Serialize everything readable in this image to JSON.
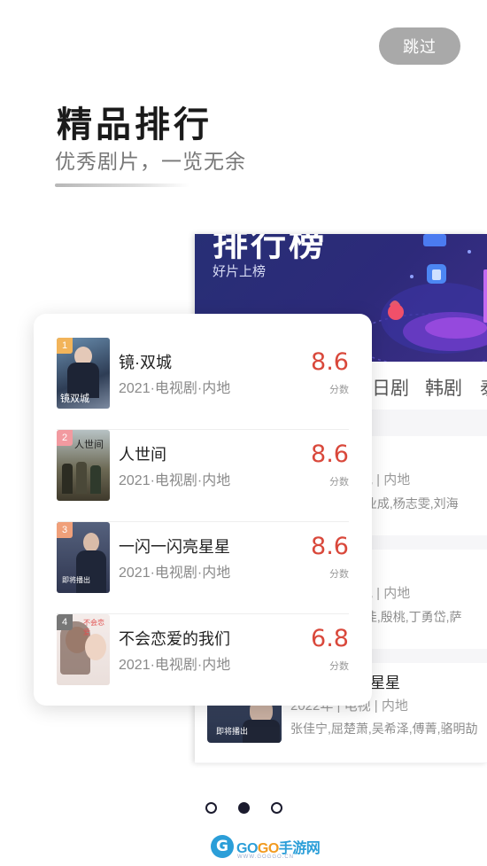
{
  "header": {
    "skip_label": "跳过",
    "title": "精品排行",
    "subtitle": "优秀剧片，一览无余"
  },
  "background_screen": {
    "banner_title": "排行榜",
    "banner_subtitle": "好片上榜",
    "tabs": [
      "日剧",
      "韩剧",
      "泰"
    ],
    "rows": [
      {
        "meta": "视 | 内地",
        "cast": ",郑业成,杨志雯,刘海"
      },
      {
        "meta": "视 | 内地",
        "cast": ",宋佳,殷桃,丁勇岱,萨"
      },
      {
        "title": "星星",
        "meta": "2022年 | 电视 | 内地",
        "cast": "张佳宁,屈楚萧,吴希泽,傅菁,骆明劼"
      }
    ],
    "poster_caption": "即将播出"
  },
  "ranking": {
    "score_label": "分数",
    "items": [
      {
        "rank": "1",
        "title": "镜·双城",
        "meta": "2021·电视剧·内地",
        "score": "8.6",
        "badge_color": "#f2b45a"
      },
      {
        "rank": "2",
        "title": "人世间",
        "meta": "2021·电视剧·内地",
        "score": "8.6",
        "badge_color": "#f29aa0"
      },
      {
        "rank": "3",
        "title": "一闪一闪亮星星",
        "meta": "2021·电视剧·内地",
        "score": "8.6",
        "badge_color": "#f0a07a"
      },
      {
        "rank": "4",
        "title": "不会恋爱的我们",
        "meta": "2021·电视剧·内地",
        "score": "6.8",
        "badge_color": "#777777"
      }
    ],
    "poster_texts": [
      "镜双城",
      "人世间",
      "即将播出",
      "不会恋爱"
    ]
  },
  "pager": {
    "count": 3,
    "active_index": 1
  },
  "watermark": {
    "brand_a": "GO",
    "brand_b": "GO",
    "brand_c": "手游网",
    "url": "WWW.GOGGO.CN"
  },
  "colors": {
    "score": "#d9483b",
    "banner": "#272f75",
    "skip_bg": "#a9a9a9",
    "logo_blue": "#2b9ed8",
    "logo_orange": "#f29a1f"
  }
}
